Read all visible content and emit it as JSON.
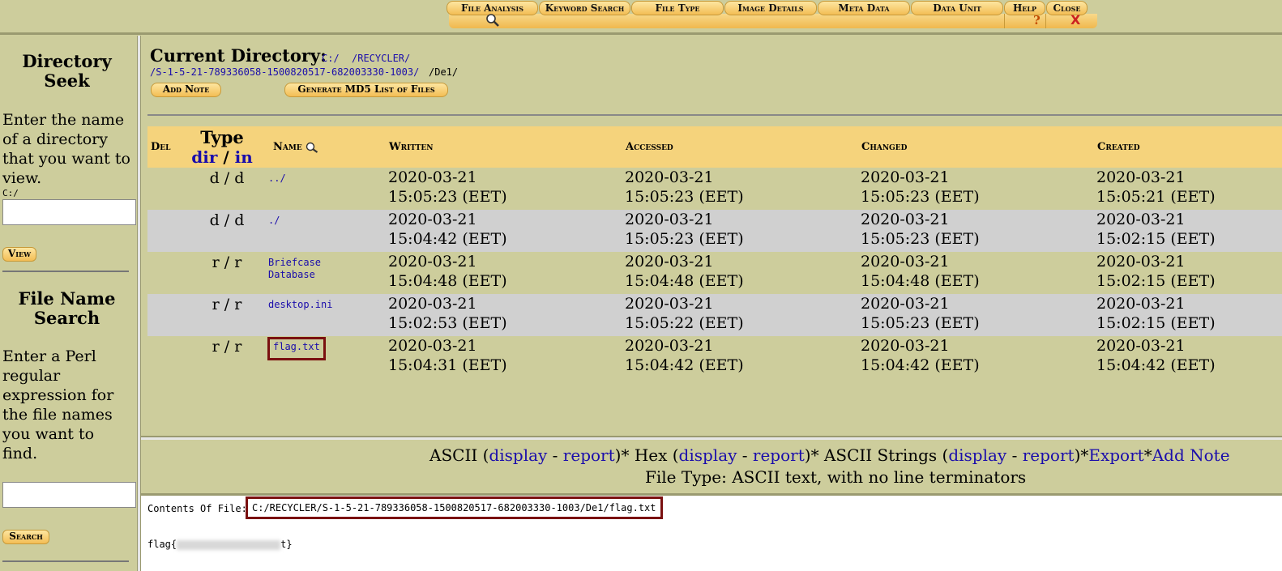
{
  "topbar": {
    "tabs": [
      {
        "label": "File Analysis"
      },
      {
        "label": "Keyword Search"
      },
      {
        "label": "File Type"
      },
      {
        "label": "Image Details"
      },
      {
        "label": "Meta Data"
      },
      {
        "label": "Data Unit"
      },
      {
        "label": "Help"
      },
      {
        "label": "Close"
      }
    ],
    "help_symbol": "?",
    "close_symbol": "X"
  },
  "sidebar": {
    "dir_title": "Directory Seek",
    "dir_desc": "Enter the name of a directory that you want to view.",
    "dir_prefix": "C:/",
    "dir_input_value": "",
    "view_label": "View",
    "file_title": "File Name Search",
    "file_desc": "Enter a Perl regular expression for the file names you want to find.",
    "file_input_value": "",
    "search_label": "Search"
  },
  "main": {
    "curdir_label": "Current Directory:",
    "path_links": [
      "C:/",
      "/RECYCLER/",
      "/S-1-5-21-789336058-1500820517-682003330-1003/"
    ],
    "path_tail": "/De1/",
    "add_note_label": "Add Note",
    "md5_label": "Generate MD5 List of Files",
    "headers": {
      "del": "Del",
      "type": "Type",
      "type_dir": "dir",
      "type_sep": "/",
      "type_in": "in",
      "name": "Name",
      "written": "Written",
      "accessed": "Accessed",
      "changed": "Changed",
      "created": "Created"
    },
    "rows": [
      {
        "type": "d / d",
        "name": "../",
        "written": [
          "2020-03-21",
          "15:05:23 (EET)"
        ],
        "accessed": [
          "2020-03-21",
          "15:05:23 (EET)"
        ],
        "changed": [
          "2020-03-21",
          "15:05:23 (EET)"
        ],
        "created": [
          "2020-03-21",
          "15:05:21 (EET)"
        ]
      },
      {
        "type": "d / d",
        "name": "./",
        "written": [
          "2020-03-21",
          "15:04:42 (EET)"
        ],
        "accessed": [
          "2020-03-21",
          "15:05:23 (EET)"
        ],
        "changed": [
          "2020-03-21",
          "15:05:23 (EET)"
        ],
        "created": [
          "2020-03-21",
          "15:02:15 (EET)"
        ]
      },
      {
        "type": "r / r",
        "name": "Briefcase Database",
        "name_lines": [
          "Briefcase",
          "Database"
        ],
        "written": [
          "2020-03-21",
          "15:04:48 (EET)"
        ],
        "accessed": [
          "2020-03-21",
          "15:04:48 (EET)"
        ],
        "changed": [
          "2020-03-21",
          "15:04:48 (EET)"
        ],
        "created": [
          "2020-03-21",
          "15:02:15 (EET)"
        ]
      },
      {
        "type": "r / r",
        "name": "desktop.ini",
        "written": [
          "2020-03-21",
          "15:02:53 (EET)"
        ],
        "accessed": [
          "2020-03-21",
          "15:05:22 (EET)"
        ],
        "changed": [
          "2020-03-21",
          "15:05:23 (EET)"
        ],
        "created": [
          "2020-03-21",
          "15:02:15 (EET)"
        ]
      },
      {
        "type": "r / r",
        "name": "flag.txt",
        "written": [
          "2020-03-21",
          "15:04:31 (EET)"
        ],
        "accessed": [
          "2020-03-21",
          "15:04:42 (EET)"
        ],
        "changed": [
          "2020-03-21",
          "15:04:42 (EET)"
        ],
        "created": [
          "2020-03-21",
          "15:04:42 (EET)"
        ]
      }
    ]
  },
  "viewbar": {
    "ascii": "ASCII (",
    "display": "display",
    "dash": "-",
    "report": "report",
    "close_sep": ")",
    "star": "*",
    "hex": "Hex (",
    "strings": "ASCII Strings (",
    "export": "Export",
    "add_note": "Add Note",
    "file_type": "File Type: ASCII text, with no line terminators"
  },
  "content": {
    "label": "Contents Of File:",
    "path": "C:/RECYCLER/S-1-5-21-789336058-1500820517-682003330-1003/De1/flag.txt",
    "text_start": "flag{",
    "text_end": "t}"
  },
  "colors": {
    "background": "#cdcd9c",
    "header_row": "#f5d37c",
    "alt_row": "#d0d0d0",
    "highlight": "#7a1010",
    "link": "#1a0dab"
  }
}
